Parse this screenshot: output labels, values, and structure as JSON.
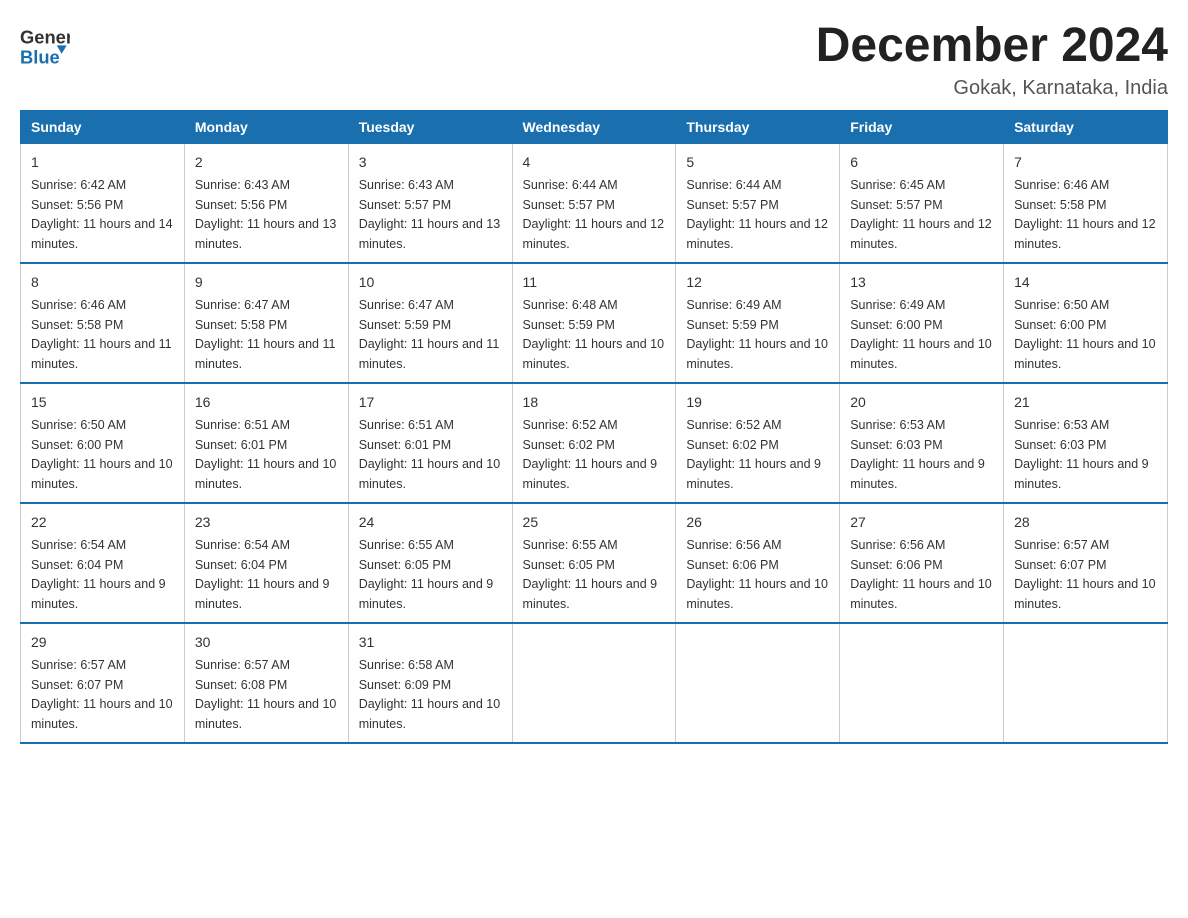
{
  "logo": {
    "line1": "General",
    "line2": "Blue"
  },
  "title": "December 2024",
  "subtitle": "Gokak, Karnataka, India",
  "headers": [
    "Sunday",
    "Monday",
    "Tuesday",
    "Wednesday",
    "Thursday",
    "Friday",
    "Saturday"
  ],
  "weeks": [
    [
      {
        "day": "1",
        "sunrise": "6:42 AM",
        "sunset": "5:56 PM",
        "daylight": "11 hours and 14 minutes."
      },
      {
        "day": "2",
        "sunrise": "6:43 AM",
        "sunset": "5:56 PM",
        "daylight": "11 hours and 13 minutes."
      },
      {
        "day": "3",
        "sunrise": "6:43 AM",
        "sunset": "5:57 PM",
        "daylight": "11 hours and 13 minutes."
      },
      {
        "day": "4",
        "sunrise": "6:44 AM",
        "sunset": "5:57 PM",
        "daylight": "11 hours and 12 minutes."
      },
      {
        "day": "5",
        "sunrise": "6:44 AM",
        "sunset": "5:57 PM",
        "daylight": "11 hours and 12 minutes."
      },
      {
        "day": "6",
        "sunrise": "6:45 AM",
        "sunset": "5:57 PM",
        "daylight": "11 hours and 12 minutes."
      },
      {
        "day": "7",
        "sunrise": "6:46 AM",
        "sunset": "5:58 PM",
        "daylight": "11 hours and 12 minutes."
      }
    ],
    [
      {
        "day": "8",
        "sunrise": "6:46 AM",
        "sunset": "5:58 PM",
        "daylight": "11 hours and 11 minutes."
      },
      {
        "day": "9",
        "sunrise": "6:47 AM",
        "sunset": "5:58 PM",
        "daylight": "11 hours and 11 minutes."
      },
      {
        "day": "10",
        "sunrise": "6:47 AM",
        "sunset": "5:59 PM",
        "daylight": "11 hours and 11 minutes."
      },
      {
        "day": "11",
        "sunrise": "6:48 AM",
        "sunset": "5:59 PM",
        "daylight": "11 hours and 10 minutes."
      },
      {
        "day": "12",
        "sunrise": "6:49 AM",
        "sunset": "5:59 PM",
        "daylight": "11 hours and 10 minutes."
      },
      {
        "day": "13",
        "sunrise": "6:49 AM",
        "sunset": "6:00 PM",
        "daylight": "11 hours and 10 minutes."
      },
      {
        "day": "14",
        "sunrise": "6:50 AM",
        "sunset": "6:00 PM",
        "daylight": "11 hours and 10 minutes."
      }
    ],
    [
      {
        "day": "15",
        "sunrise": "6:50 AM",
        "sunset": "6:00 PM",
        "daylight": "11 hours and 10 minutes."
      },
      {
        "day": "16",
        "sunrise": "6:51 AM",
        "sunset": "6:01 PM",
        "daylight": "11 hours and 10 minutes."
      },
      {
        "day": "17",
        "sunrise": "6:51 AM",
        "sunset": "6:01 PM",
        "daylight": "11 hours and 10 minutes."
      },
      {
        "day": "18",
        "sunrise": "6:52 AM",
        "sunset": "6:02 PM",
        "daylight": "11 hours and 9 minutes."
      },
      {
        "day": "19",
        "sunrise": "6:52 AM",
        "sunset": "6:02 PM",
        "daylight": "11 hours and 9 minutes."
      },
      {
        "day": "20",
        "sunrise": "6:53 AM",
        "sunset": "6:03 PM",
        "daylight": "11 hours and 9 minutes."
      },
      {
        "day": "21",
        "sunrise": "6:53 AM",
        "sunset": "6:03 PM",
        "daylight": "11 hours and 9 minutes."
      }
    ],
    [
      {
        "day": "22",
        "sunrise": "6:54 AM",
        "sunset": "6:04 PM",
        "daylight": "11 hours and 9 minutes."
      },
      {
        "day": "23",
        "sunrise": "6:54 AM",
        "sunset": "6:04 PM",
        "daylight": "11 hours and 9 minutes."
      },
      {
        "day": "24",
        "sunrise": "6:55 AM",
        "sunset": "6:05 PM",
        "daylight": "11 hours and 9 minutes."
      },
      {
        "day": "25",
        "sunrise": "6:55 AM",
        "sunset": "6:05 PM",
        "daylight": "11 hours and 9 minutes."
      },
      {
        "day": "26",
        "sunrise": "6:56 AM",
        "sunset": "6:06 PM",
        "daylight": "11 hours and 10 minutes."
      },
      {
        "day": "27",
        "sunrise": "6:56 AM",
        "sunset": "6:06 PM",
        "daylight": "11 hours and 10 minutes."
      },
      {
        "day": "28",
        "sunrise": "6:57 AM",
        "sunset": "6:07 PM",
        "daylight": "11 hours and 10 minutes."
      }
    ],
    [
      {
        "day": "29",
        "sunrise": "6:57 AM",
        "sunset": "6:07 PM",
        "daylight": "11 hours and 10 minutes."
      },
      {
        "day": "30",
        "sunrise": "6:57 AM",
        "sunset": "6:08 PM",
        "daylight": "11 hours and 10 minutes."
      },
      {
        "day": "31",
        "sunrise": "6:58 AM",
        "sunset": "6:09 PM",
        "daylight": "11 hours and 10 minutes."
      },
      {
        "day": "",
        "sunrise": "",
        "sunset": "",
        "daylight": ""
      },
      {
        "day": "",
        "sunrise": "",
        "sunset": "",
        "daylight": ""
      },
      {
        "day": "",
        "sunrise": "",
        "sunset": "",
        "daylight": ""
      },
      {
        "day": "",
        "sunrise": "",
        "sunset": "",
        "daylight": ""
      }
    ]
  ]
}
